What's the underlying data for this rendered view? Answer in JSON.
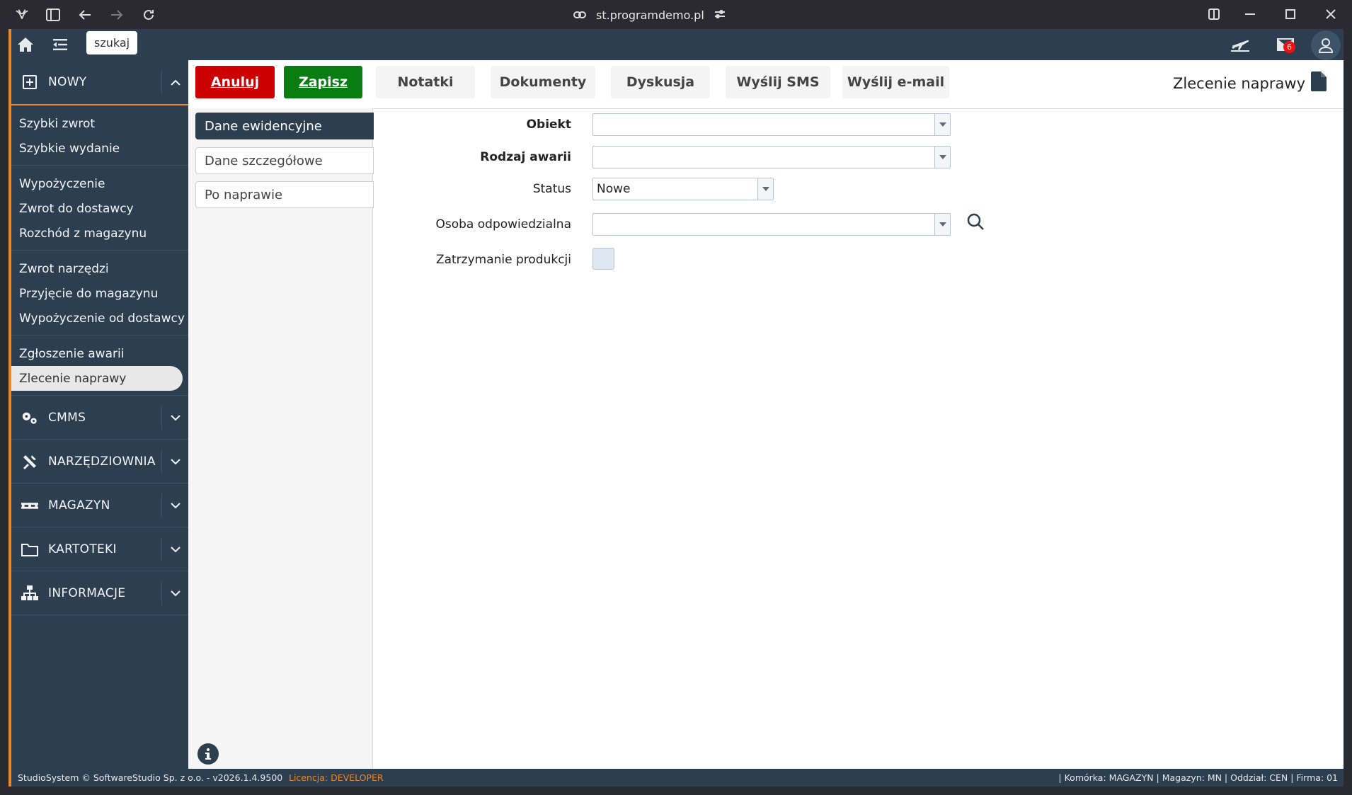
{
  "browser": {
    "url": "st.programdemo.pl"
  },
  "topbar": {
    "search_label": "szukaj",
    "mail_count": "6"
  },
  "sidebar": {
    "nowy_label": "NOWY",
    "groups": [
      [
        "Szybki zwrot",
        "Szybkie wydanie"
      ],
      [
        "Wypożyczenie",
        "Zwrot do dostawcy",
        "Rozchód z magazynu"
      ],
      [
        "Zwrot narzędzi",
        "Przyjęcie do magazynu",
        "Wypożyczenie od dostawcy"
      ],
      [
        "Zgłoszenie awarii",
        "Zlecenie naprawy"
      ]
    ],
    "sections": [
      {
        "label": "CMMS",
        "icon": "gears-icon"
      },
      {
        "label": "NARZĘDZIOWNIA",
        "icon": "tools-icon"
      },
      {
        "label": "MAGAZYN",
        "icon": "pallet-icon"
      },
      {
        "label": "KARTOTEKI",
        "icon": "folder-icon"
      },
      {
        "label": "INFORMACJE",
        "icon": "sitemap-icon"
      }
    ]
  },
  "toolbar": {
    "cancel_label": "Anuluj",
    "save_label": "Zapisz",
    "tabs": [
      "Notatki",
      "Dokumenty",
      "Dyskusja",
      "Wyślij SMS",
      "Wyślij e-mail"
    ],
    "page_title": "Zlecenie naprawy"
  },
  "subtabs": [
    "Dane ewidencyjne",
    "Dane szczegółowe",
    "Po naprawie"
  ],
  "form": {
    "obiekt_label": "Obiekt",
    "obiekt_value": "",
    "rodzaj_label": "Rodzaj awarii",
    "rodzaj_value": "",
    "status_label": "Status",
    "status_value": "Nowe",
    "osoba_label": "Osoba odpowiedzialna",
    "osoba_value": "",
    "zatrzymanie_label": "Zatrzymanie produkcji",
    "zatrzymanie_checked": false
  },
  "footer": {
    "left": "StudioSystem © SoftwareStudio Sp. z o.o. - v2026.1.4.9500",
    "license": "Licencja: DEVELOPER",
    "right": "| Komórka: MAGAZYN | Magazyn: MN | Oddział: CEN | Firma: 01"
  },
  "colors": {
    "navy": "#2c3e50",
    "accent": "#e8882b",
    "cancel": "#cc0000",
    "save": "#0a7d12"
  }
}
